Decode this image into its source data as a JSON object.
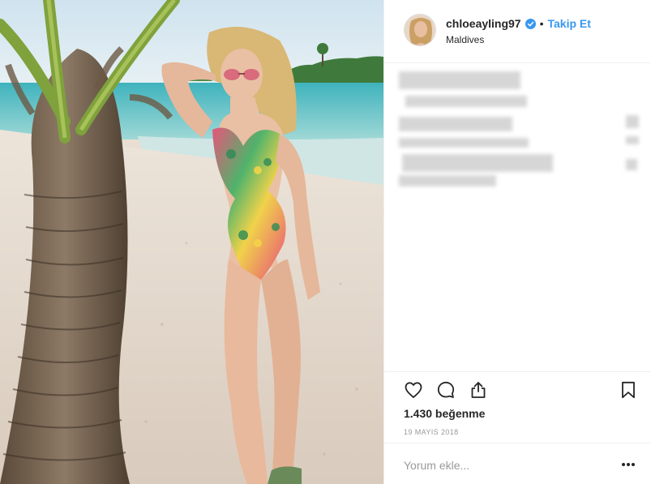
{
  "post": {
    "username": "chloeayling97",
    "follow_label": "Takip Et",
    "dot": "•",
    "location": "Maldives",
    "likes_text": "1.430 beğenme",
    "date_text": "19 MAYIS 2018"
  },
  "comment": {
    "placeholder": "Yorum ekle..."
  },
  "icons": {
    "like": "heart-icon",
    "comment": "comment-icon",
    "share": "share-icon",
    "save": "bookmark-icon",
    "more": "more-options-icon",
    "verified": "verified-badge-icon"
  },
  "colors": {
    "link_blue": "#3897f0",
    "text_dark": "#262626",
    "text_muted": "#999999",
    "divider": "#efefef"
  }
}
